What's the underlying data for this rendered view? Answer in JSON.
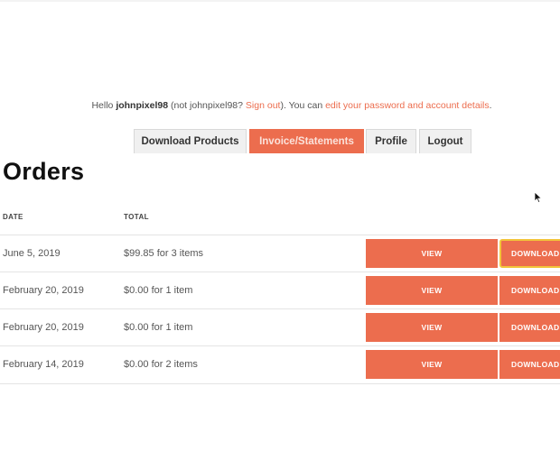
{
  "greeting": {
    "hello": "Hello ",
    "username": "johnpixel98",
    "not_prefix": " (not ",
    "not_user": "johnpixel98",
    "not_suffix": "? ",
    "sign_out": "Sign out",
    "middle": "). You can ",
    "edit_link": "edit your password and account details",
    "end": "."
  },
  "tabs": [
    {
      "label": "Download Products",
      "active": false
    },
    {
      "label": "Invoice/Statements",
      "active": true
    },
    {
      "label": "Profile",
      "active": false
    },
    {
      "label": "Logout",
      "active": false
    }
  ],
  "orders": {
    "title": "Orders",
    "columns": {
      "date": "DATE",
      "total": "TOTAL"
    },
    "view_label": "VIEW",
    "download_label": "DOWNLOAD",
    "rows": [
      {
        "date": "June 5, 2019",
        "total": "$99.85 for 3 items",
        "download_highlighted": true
      },
      {
        "date": "February 20, 2019",
        "total": "$0.00 for 1 item",
        "download_highlighted": false
      },
      {
        "date": "February 20, 2019",
        "total": "$0.00 for 1 item",
        "download_highlighted": false
      },
      {
        "date": "February 14, 2019",
        "total": "$0.00 for 2 items",
        "download_highlighted": false
      }
    ]
  },
  "colors": {
    "accent": "#ec6d4e",
    "highlight_border": "#f2c43a",
    "tab_inactive_bg": "#f0f0f0"
  },
  "icons": {
    "cursor": "mouse-pointer-icon"
  }
}
